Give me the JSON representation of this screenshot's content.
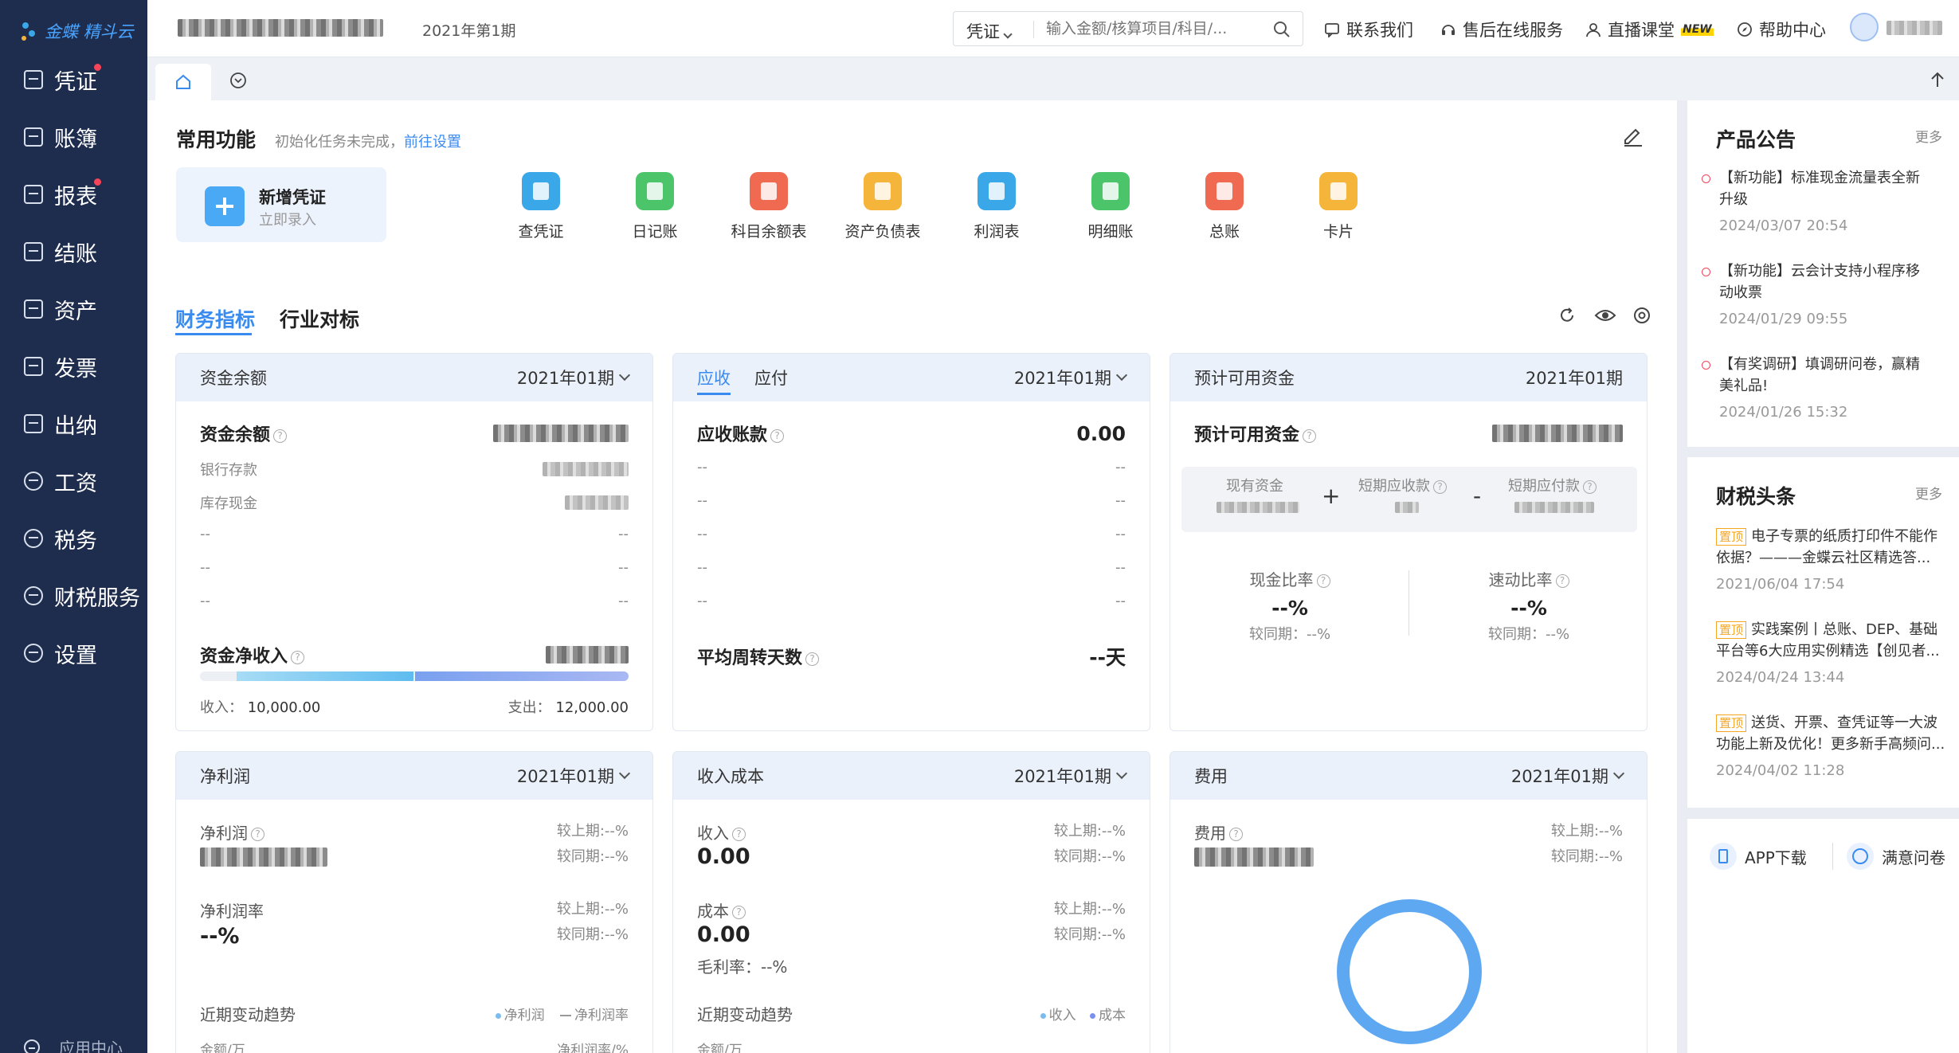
{
  "app": {
    "name": "金蝶 精斗云",
    "period": "2021年第1期"
  },
  "sidebar": {
    "items": [
      {
        "label": "凭证",
        "dot": true
      },
      {
        "label": "账簿",
        "dot": false
      },
      {
        "label": "报表",
        "dot": true
      },
      {
        "label": "结账",
        "dot": false
      },
      {
        "label": "资产",
        "dot": false
      },
      {
        "label": "发票",
        "dot": false
      },
      {
        "label": "出纳",
        "dot": false
      },
      {
        "label": "工资",
        "dot": false
      },
      {
        "label": "税务",
        "dot": false
      },
      {
        "label": "财税服务",
        "dot": false
      },
      {
        "label": "设置",
        "dot": false
      }
    ],
    "bottom_label": "应用中心"
  },
  "topbar": {
    "search_type": "凭证",
    "search_placeholder": "输入金额/核算项目/科目/...",
    "contact": "联系我们",
    "service": "售后在线服务",
    "live": "直播课堂",
    "live_badge": "NEW",
    "help": "帮助中心"
  },
  "common": {
    "title": "常用功能",
    "hint": "初始化任务未完成，",
    "hint_link": "前往设置",
    "new_voucher": "新增凭证",
    "new_voucher_sub": "立即录入",
    "items": [
      {
        "label": "查凭证",
        "color": "#3aa7e8"
      },
      {
        "label": "日记账",
        "color": "#4cc46a"
      },
      {
        "label": "科目余额表",
        "color": "#ef6a50"
      },
      {
        "label": "资产负债表",
        "color": "#f5b43a"
      },
      {
        "label": "利润表",
        "color": "#3aa7e8"
      },
      {
        "label": "明细账",
        "color": "#4cc46a"
      },
      {
        "label": "总账",
        "color": "#ef6a50"
      },
      {
        "label": "卡片",
        "color": "#f5b43a"
      }
    ]
  },
  "tabs": {
    "active": "财务指标",
    "other": "行业对标"
  },
  "cash": {
    "head": "资金余额",
    "period": "2021年01期",
    "title": "资金余额",
    "rows": [
      "银行存款",
      "库存现金",
      "--",
      "--",
      "--"
    ],
    "dash": "--",
    "net_title": "资金净收入",
    "income_label": "收入：",
    "income": "10,000.00",
    "expense_label": "支出：",
    "expense": "12,000.00",
    "income_fraction": 0.455
  },
  "ar": {
    "tab_active": "应收",
    "tab_other": "应付",
    "period": "2021年01期",
    "title": "应收账款",
    "value": "0.00",
    "dash": "--",
    "turnover_title": "平均周转天数",
    "turnover_value": "--天"
  },
  "funds": {
    "head": "预计可用资金",
    "period": "2021年01期",
    "title": "预计可用资金",
    "existing": "现有资金",
    "plus": "+",
    "receivable": "短期应收款",
    "minus": "-",
    "payable": "短期应付款",
    "cash_ratio": "现金比率",
    "cash_ratio_value": "--%",
    "cash_ratio_yoy": "较同期：--%",
    "quick_ratio": "速动比率",
    "quick_ratio_value": "--%",
    "quick_ratio_yoy": "较同期：--%"
  },
  "profit": {
    "head": "净利润",
    "period": "2021年01期",
    "net_label": "净利润",
    "mom": "较上期:--%",
    "yoy": "较同期:--%",
    "rate_label": "净利润率",
    "rate_value": "--%",
    "trend": "近期变动趋势",
    "legend1": "净利润",
    "legend2": "净利润率",
    "axis_left": "金额/万",
    "axis_right": "净利润率/%"
  },
  "income_cost": {
    "head": "收入成本",
    "period": "2021年01期",
    "income_label": "收入",
    "income_value": "0.00",
    "cost_label": "成本",
    "cost_value": "0.00",
    "margin": "毛利率：--%",
    "mom": "较上期:--%",
    "yoy": "较同期:--%",
    "trend": "近期变动趋势",
    "legend1": "收入",
    "legend2": "成本",
    "axis_left": "金额/万"
  },
  "expense": {
    "head": "费用",
    "period": "2021年01期",
    "label": "费用",
    "mom": "较上期:--%",
    "yoy": "较同期:--%"
  },
  "announcements": {
    "title": "产品公告",
    "more": "更多",
    "items": [
      {
        "text": "【新功能】标准现金流量表全新升级",
        "date": "2024/03/07 20:54"
      },
      {
        "text": "【新功能】云会计支持小程序移动收票",
        "date": "2024/01/29 09:55"
      },
      {
        "text": "【有奖调研】填调研问卷，赢精美礼品!",
        "date": "2024/01/26 15:32"
      }
    ]
  },
  "news": {
    "title": "财税头条",
    "more": "更多",
    "pin": "置顶",
    "items": [
      {
        "text": "电子专票的纸质打印件不能作依据？———金蝶云社区精选答...",
        "date": "2021/06/04 17:54"
      },
      {
        "text": "实践案例丨总账、DEP、基础平台等6大应用实例精选【创见者...",
        "date": "2024/04/24 13:44"
      },
      {
        "text": "送货、开票、查凭证等一大波功能上新及优化！更多新手高频问...",
        "date": "2024/04/02 11:28"
      }
    ]
  },
  "footer_links": {
    "app": "APP下载",
    "survey": "满意问卷"
  }
}
